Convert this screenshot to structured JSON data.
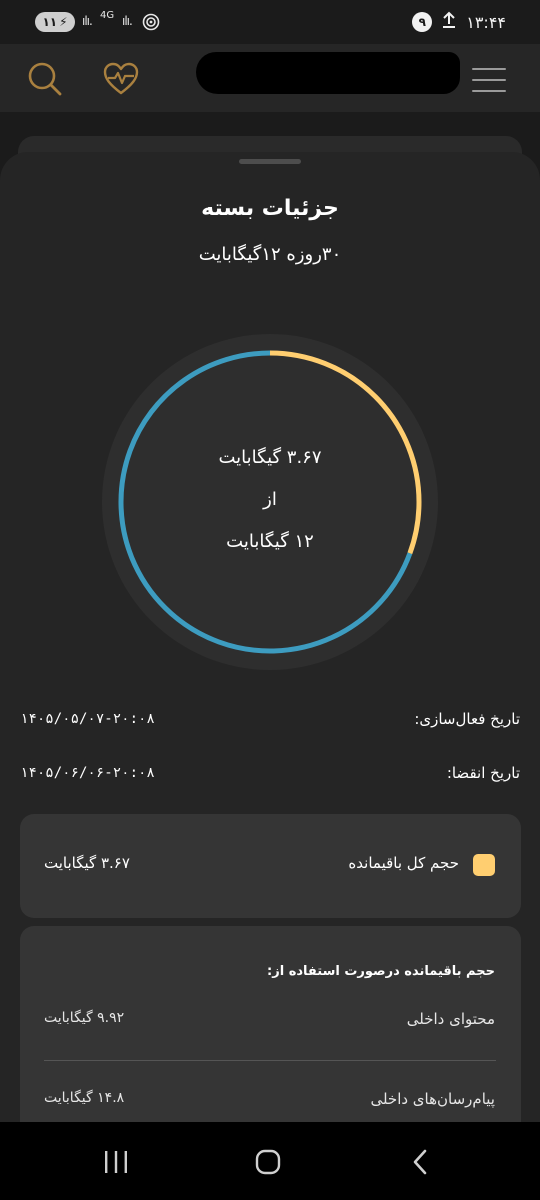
{
  "status_bar": {
    "battery": "۱۱",
    "network": "4G",
    "notification_count": "۹",
    "time": "۱۳:۴۴"
  },
  "header": {
    "search_icon": "search-icon",
    "health_icon": "heart-pulse-icon",
    "menu_icon": "hamburger-menu-icon"
  },
  "sheet": {
    "title": "جزئیات بسته",
    "subtitle": "۳۰روزه ۱۲گیگابایت"
  },
  "usage": {
    "remaining": "۳.۶۷ گیگابایت",
    "of": "از",
    "total": "۱۲ گیگابایت"
  },
  "chart_data": {
    "type": "pie",
    "total_gb": 12,
    "remaining_gb": 3.67,
    "colors": {
      "remaining": "#ffce70",
      "used": "#3d9cc0"
    }
  },
  "dates": {
    "activation_label": "تاریخ فعال‌سازی:",
    "activation_value": "۱۴۰۵/۰۵/۰۷-۲۰:۰۸",
    "expiry_label": "تاریخ انقضا:",
    "expiry_value": "۱۴۰۵/۰۶/۰۶-۲۰:۰۸"
  },
  "total_remaining": {
    "label": "حجم کل باقیمانده",
    "value": "۳.۶۷ گیگابایت"
  },
  "details": {
    "title": "حجم باقیمانده درصورت استفاده از:",
    "rows": [
      {
        "label": "محتوای داخلی",
        "value": "۹.۹۲ گیگابایت"
      },
      {
        "label": "پیام‌رسان‌های داخلی",
        "value": "۱۴.۸ گیگابایت"
      }
    ]
  },
  "nav": {
    "recents": "recents-icon",
    "home": "home-icon",
    "back": "back-icon"
  },
  "colors": {
    "accent_gold": "#a9803f",
    "yellow": "#ffce70",
    "blue": "#3d9cc0"
  }
}
